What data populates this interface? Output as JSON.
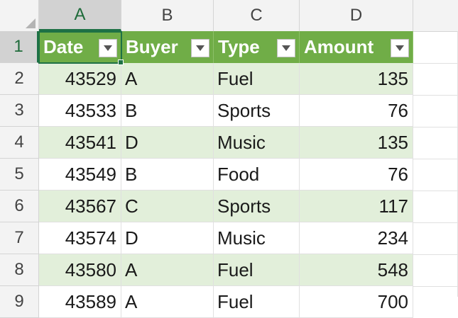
{
  "columns": [
    "A",
    "B",
    "C",
    "D"
  ],
  "rows": [
    "1",
    "2",
    "3",
    "4",
    "5",
    "6",
    "7",
    "8",
    "9"
  ],
  "table": {
    "headers": [
      "Date",
      "Buyer",
      "Type",
      "Amount"
    ],
    "records": [
      {
        "date": "43529",
        "buyer": "A",
        "type": "Fuel",
        "amount": "135"
      },
      {
        "date": "43533",
        "buyer": "B",
        "type": "Sports",
        "amount": "76"
      },
      {
        "date": "43541",
        "buyer": "D",
        "type": "Music",
        "amount": "135"
      },
      {
        "date": "43549",
        "buyer": "B",
        "type": "Food",
        "amount": "76"
      },
      {
        "date": "43567",
        "buyer": "C",
        "type": "Sports",
        "amount": "117"
      },
      {
        "date": "43574",
        "buyer": "D",
        "type": "Music",
        "amount": "234"
      },
      {
        "date": "43580",
        "buyer": "A",
        "type": "Fuel",
        "amount": "548"
      },
      {
        "date": "43589",
        "buyer": "A",
        "type": "Fuel",
        "amount": "700"
      }
    ]
  },
  "colors": {
    "header_fill": "#70ad47",
    "band_fill": "#e2efda",
    "selection": "#1e7145"
  },
  "icons": {
    "filter_dropdown": "chevron-down-icon"
  }
}
